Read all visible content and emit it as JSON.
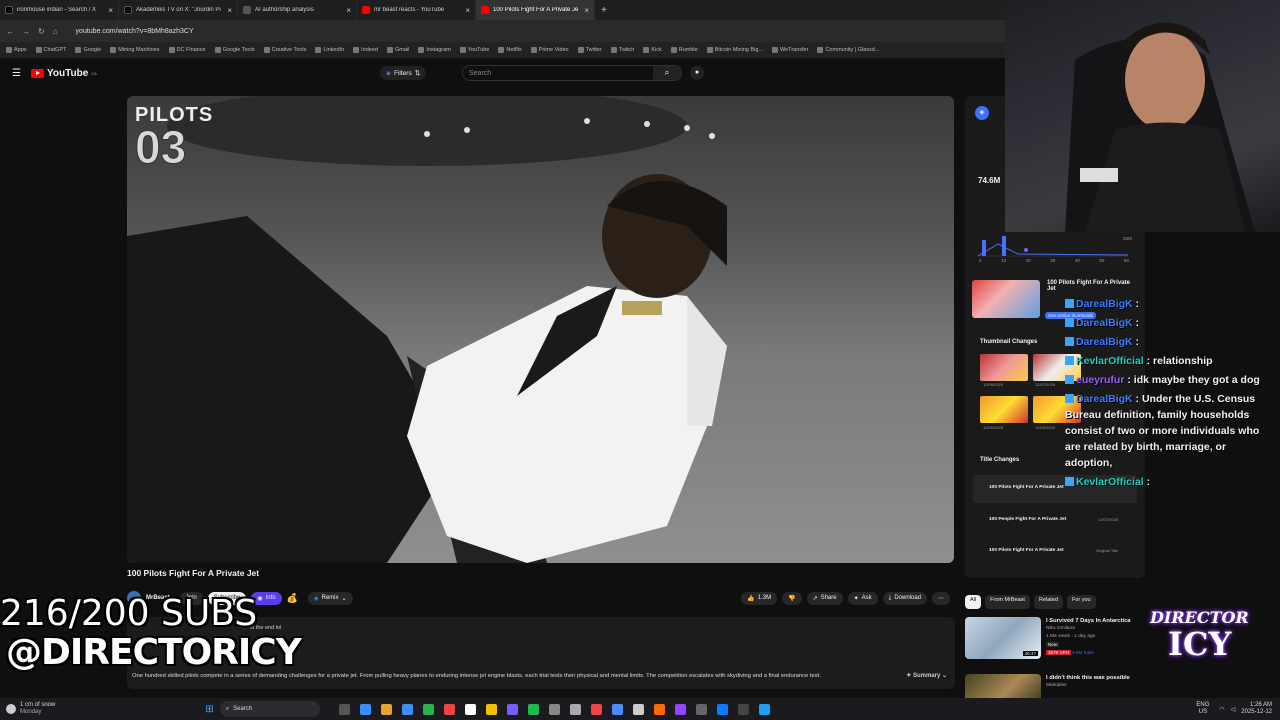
{
  "tabs": [
    {
      "title": "ironmouse indian - Search / X",
      "color": "#000"
    },
    {
      "title": "Akademiks TV on X: \"Jourdin Pi",
      "color": "#000"
    },
    {
      "title": "AI authorship analysis",
      "color": "#3a3a3a"
    },
    {
      "title": "mr beast reacts - YouTube",
      "color": "#ff0000"
    },
    {
      "title": "100 Pilots Fight For A Private Je",
      "color": "#ff0000"
    }
  ],
  "address": {
    "url": "youtube.com/watch?v=8bMh8azh3CY"
  },
  "bookmarks": [
    "Apps",
    "ChatGPT",
    "Google",
    "Mining Machines",
    "DC Finance",
    "Google Tools",
    "Creative Tools",
    "LinkedIn",
    "Indeed",
    "Gmail",
    "Instagram",
    "YouTube",
    "Netflix",
    "Prime Video",
    "Twitter",
    "Twitch",
    "Kick",
    "Rumble",
    "Bitcoin Mining Big...",
    "WeTransfer",
    "Community | Glassd..."
  ],
  "yt": {
    "logo": "YouTube",
    "region": "CA",
    "filters": "Filters",
    "search_placeholder": "Search"
  },
  "video": {
    "overlay_top": "PILOTS",
    "overlay_num": "03",
    "title": "100 Pilots Fight For A Private Jet",
    "channel": "MrBeast",
    "join": "Join",
    "subscribe": "Subscribe",
    "info": "Info",
    "remix": "Remix",
    "likes": "1.3M",
    "share": "Share",
    "ask": "Ask",
    "download": "Download",
    "desc_partial": "st the end lol",
    "summary": "One hundred skilled pilots compete in a series of demanding challenges for a private jet. From pulling heavy planes to enduring intense jet engine blasts, each trial tests their physical and mental limits. The competition escalates with skydiving and a final endurance test.",
    "summary_btn": "Summary"
  },
  "stream": {
    "subs": "216/200 SUBS",
    "handle": "@DIRECTORICY",
    "logo_top": "DIRECTOR",
    "logo_bottom": "ICY"
  },
  "side": {
    "views": "74.6M",
    "tick_labels": [
      "0",
      "10",
      "20",
      "30",
      "40",
      "50",
      "60"
    ],
    "axis_max": "25M",
    "current_title": "100 Pilots Fight For A Private Jet",
    "see_similar": "See similar thumbnails",
    "thumb_header": "Thumbnail Changes",
    "thumb_dates": [
      "12/09/2025",
      "12/07/2025",
      "12/06/2025",
      "12/05/2025"
    ],
    "title_header": "Title Changes",
    "titles": [
      "100 Pilots Fight For A Private Jet",
      "100 People Fight For A Private Jet",
      "100 Pilots Fight For A Private Jet"
    ],
    "title_meta": [
      "12/07/2025",
      "Original Title"
    ]
  },
  "chat": [
    {
      "user": "DarealBigK",
      "text": ""
    },
    {
      "user": "DarealBigK",
      "text": ""
    },
    {
      "user": "DarealBigK",
      "text": ""
    },
    {
      "user": "KevlarOfficial",
      "text": "relationship"
    },
    {
      "user": "eueyrufur",
      "text": "idk maybe they got a dog"
    },
    {
      "user": "DarealBigK",
      "text": "Under the U.S. Census Bureau definition, family households consist of two or more individuals who are related by birth, marriage, or adoption,"
    },
    {
      "user": "KevlarOfficial",
      "text": ""
    }
  ],
  "related_tabs": [
    "All",
    "From MrBeast",
    "Related",
    "For you"
  ],
  "related": [
    {
      "title": "I Survived 7 Days In Antarctica",
      "channel": "Niko Omilana",
      "meta": "1.6M views · 1 day ago",
      "badge": "New",
      "duration": "46:47",
      "extra": "357K VPH",
      "extra2": "6.6M Subs"
    },
    {
      "title": "I didn't think this was possible",
      "channel": "Markiplier",
      "meta": "",
      "duration": "",
      "extra": ""
    }
  ],
  "taskbar": {
    "weather": "1 cm of snow",
    "weather_day": "Monday",
    "search": "Search",
    "lang": "ENG",
    "lang2": "US",
    "time": "1:26 AM",
    "date": "2025-12-12"
  },
  "colors": {
    "accent": "#ff0000",
    "info_chip": "#5a3cf5",
    "chat_blue": "#3d7bff",
    "chat_teal": "#1fd1c0"
  }
}
